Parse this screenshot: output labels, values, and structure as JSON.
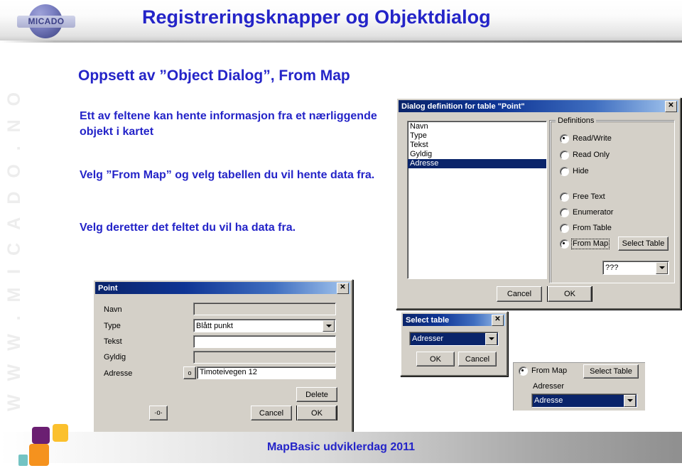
{
  "header": {
    "title": "Registreringsknapper og Objektdialog",
    "logo_text": "MICADO"
  },
  "watermark": "W W W . M I C A D O . N O",
  "slide": {
    "heading": "Oppsett av ”Object Dialog”, From Map",
    "paragraph_1": "Ett av feltene kan hente informasjon fra et nærliggende objekt i kartet",
    "paragraph_2": "Velg ”From Map” og velg tabellen du vil hente data fra.",
    "paragraph_3": "Velg deretter det feltet du vil ha data fra."
  },
  "dialog_definition": {
    "title": "Dialog definition for table \"Point\"",
    "close_label": "✕",
    "fields": [
      "Navn",
      "Type",
      "Tekst",
      "Gyldig",
      "Adresse"
    ],
    "selected_field": "Adresse",
    "group_title": "Definitions",
    "radios_access": [
      {
        "label": "Read/Write",
        "selected": true
      },
      {
        "label": "Read Only",
        "selected": false
      },
      {
        "label": "Hide",
        "selected": false
      }
    ],
    "radios_source": [
      {
        "label": "Free Text",
        "selected": false
      },
      {
        "label": "Enumerator",
        "selected": false
      },
      {
        "label": "From Table",
        "selected": false
      },
      {
        "label": "From Map",
        "selected": true
      }
    ],
    "select_table_button": "Select Table",
    "field_combo_value": "???",
    "cancel_label": "Cancel",
    "ok_label": "OK"
  },
  "select_table_dialog": {
    "title": "Select table",
    "close_label": "✕",
    "combo_value": "Adresser",
    "ok_label": "OK",
    "cancel_label": "Cancel"
  },
  "from_map_panel": {
    "radio_label": "From Map",
    "button_label": "Select Table",
    "table_label": "Adresser",
    "combo_value": "Adresse"
  },
  "point_dialog": {
    "title": "Point",
    "close_label": "✕",
    "rows": [
      {
        "label": "Navn",
        "value": "",
        "type": "text-disabled"
      },
      {
        "label": "Type",
        "value": "Blått punkt",
        "type": "combo"
      },
      {
        "label": "Tekst",
        "value": "",
        "type": "text"
      },
      {
        "label": "Gyldig",
        "value": "",
        "type": "text-disabled"
      },
      {
        "label": "Adresse",
        "value": "Timoteivegen 12",
        "type": "text-with-pick"
      }
    ],
    "pick_button_label": "o",
    "map_button_label": "·o·",
    "delete_label": "Delete",
    "cancel_label": "Cancel",
    "ok_label": "OK"
  },
  "footer": {
    "text": "MapBasic udviklerdag 2011"
  },
  "colors": {
    "accent_blue": "#2424c8",
    "titlebar_dark": "#0a246a",
    "dialog_face": "#d4d0c8",
    "deco_purple": "#6b1f72",
    "deco_yellow": "#fbc02d",
    "deco_orange": "#f5921e",
    "deco_teal": "#73c3c3"
  }
}
